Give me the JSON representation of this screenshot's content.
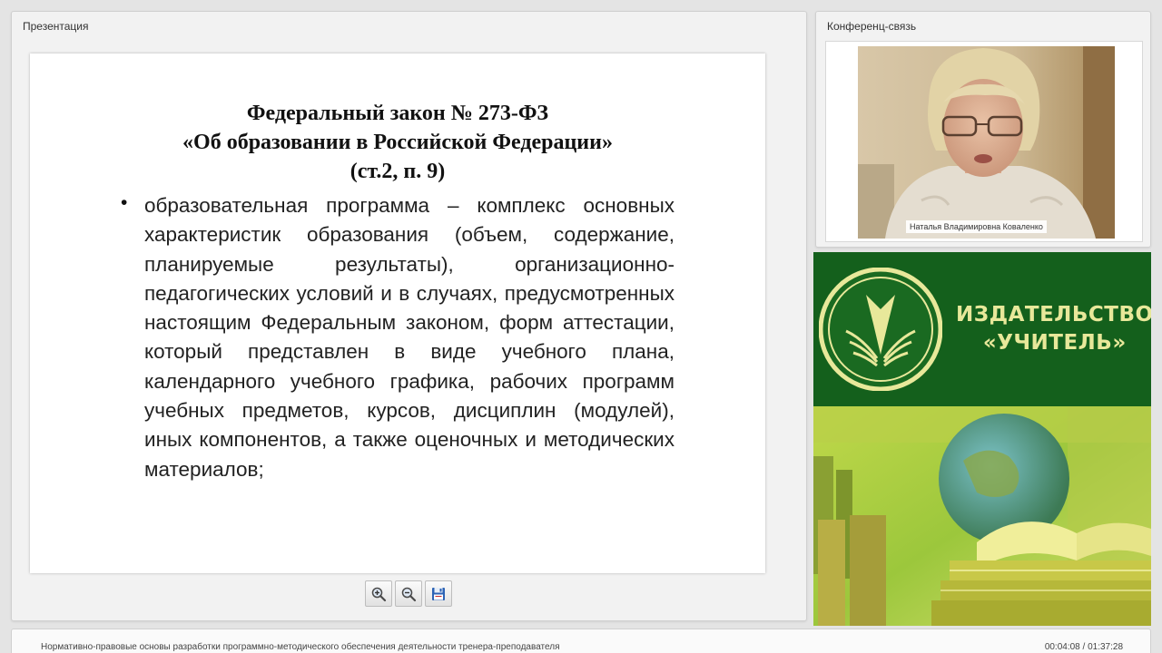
{
  "presentation": {
    "panel_title": "Презентация",
    "slide": {
      "title_lines": [
        "Федеральный закон  № 273-ФЗ",
        "«Об образовании в Российской Федерации»",
        "(ст.2, п. 9)"
      ],
      "bullet": "•",
      "body": "образовательная программа – комплекс основных характеристик образования (объем, содержание, планируемые результаты), организационно-педагогических условий и в случаях, предусмотренных настоящим Федеральным законом, форм аттестации, который представлен в виде учебного плана, календарного учебного графика, рабочих программ учебных предметов, курсов, дисциплин (модулей), иных компонентов, а также оценочных и методических материалов;"
    },
    "toolbar": {
      "zoom_in_icon": "zoom-in-icon",
      "zoom_out_icon": "zoom-out-icon",
      "save_icon": "floppy-disk-icon"
    }
  },
  "conference": {
    "panel_title": "Конференц-связь",
    "participant_name": "Наталья Владимировна Коваленко"
  },
  "banner": {
    "brand_line1": "ИЗДАТЕЛЬСТВО",
    "brand_line2": "«УЧИТЕЛЬ»"
  },
  "footer": {
    "title": "Нормативно-правовые основы разработки программно-методического обеспечения деятельности тренера-преподавателя",
    "time": "00:04:08 / 01:37:28"
  },
  "colors": {
    "brand_green": "#14601c",
    "brand_text": "#e8e89a",
    "panel_bg": "#f2f2f2",
    "page_bg": "#e4e4e4"
  }
}
